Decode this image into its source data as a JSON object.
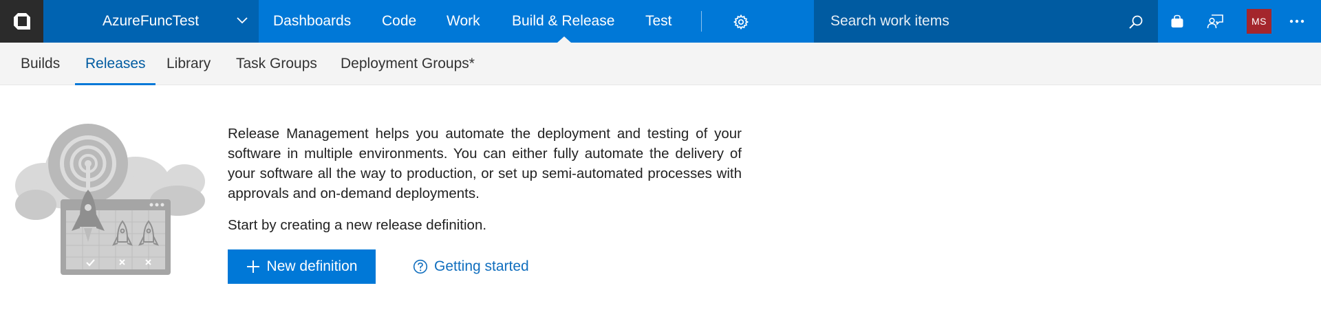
{
  "topbar": {
    "project_name": "AzureFuncTest",
    "hubs": [
      {
        "label": "Dashboards"
      },
      {
        "label": "Code"
      },
      {
        "label": "Work"
      },
      {
        "label": "Build & Release",
        "active": true
      },
      {
        "label": "Test"
      }
    ],
    "search_placeholder": "Search work items",
    "avatar_initials": "MS",
    "icons": {
      "logo": "visual-studio-logo-icon",
      "project_menu": "chevron-down-icon",
      "settings": "gear-icon",
      "search": "search-icon",
      "marketplace": "shopping-bag-icon",
      "feedback": "feedback-icon",
      "more": "ellipsis-icon"
    }
  },
  "subnav": {
    "tabs": [
      {
        "label": "Builds"
      },
      {
        "label": "Releases",
        "active": true
      },
      {
        "label": "Library"
      },
      {
        "label": "Task Groups"
      },
      {
        "label": "Deployment Groups*"
      }
    ]
  },
  "main": {
    "illustration_icon": "rocket-release-illustration-icon",
    "description": "Release Management helps you automate the deployment and testing of your software in multiple environments. You can either fully automate the delivery of your software all the way to production, or set up semi-automated processes with approvals and on-demand deployments.",
    "hint": "Start by creating a new release definition.",
    "new_definition_label": "New definition",
    "getting_started_label": "Getting started"
  },
  "colors": {
    "brand_blue": "#0078d7",
    "project_blue": "#0063b1",
    "search_blue": "#005ba1",
    "logo_dark": "#2b2b2b",
    "avatar_red": "#a4262c",
    "link_blue": "#106ebe",
    "subbar_bg": "#f4f4f4"
  }
}
